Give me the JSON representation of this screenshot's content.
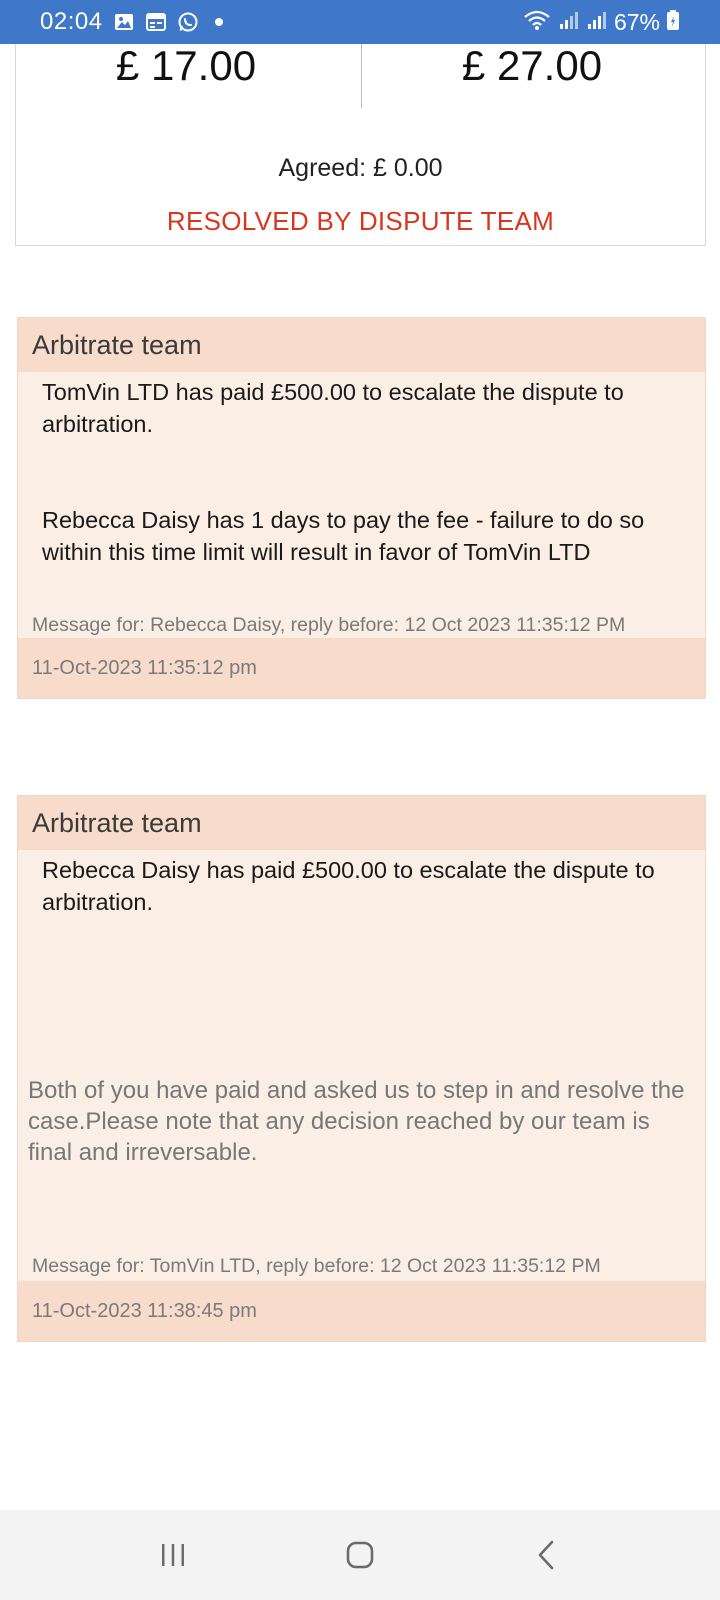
{
  "status_bar": {
    "time": "02:04",
    "icons": [
      "gallery-icon",
      "calendar-icon",
      "whatsapp-icon",
      "notification-dot"
    ],
    "right_icons": [
      "wifi-icon",
      "signal-icon",
      "signal-icon-2"
    ],
    "battery_percent": "67%",
    "background_color": "#3f78c8"
  },
  "summary": {
    "amount_left": "£ 17.00",
    "amount_right": "£ 27.00",
    "agreed": "Agreed: £ 0.00",
    "status": "RESOLVED BY DISPUTE TEAM",
    "status_color": "#d9361f"
  },
  "messages": [
    {
      "sender": "Arbitrate team",
      "body": [
        "TomVin LTD has paid £500.00 to escalate the dispute to arbitration.",
        "Rebecca Daisy has 1 days to pay the fee - failure to do so within this time limit will result in favor of TomVin LTD"
      ],
      "message_for": "Message for: Rebecca Daisy, reply before: 12 Oct 2023 11:35:12 PM",
      "timestamp": "11-Oct-2023 11:35:12 pm"
    },
    {
      "sender": "Arbitrate team",
      "body": [
        "Rebecca Daisy has paid £500.00 to escalate the dispute to arbitration."
      ],
      "note": "Both of you have paid and asked us to step in and resolve the case.Please note that any decision reached by our team is final and irreversable.",
      "message_for": "Message for: TomVin LTD, reply before: 12 Oct 2023 11:35:12 PM",
      "timestamp": "11-Oct-2023 11:38:45 pm"
    }
  ],
  "navigation": {
    "buttons": [
      "recent-apps-icon",
      "home-icon",
      "back-icon"
    ]
  }
}
